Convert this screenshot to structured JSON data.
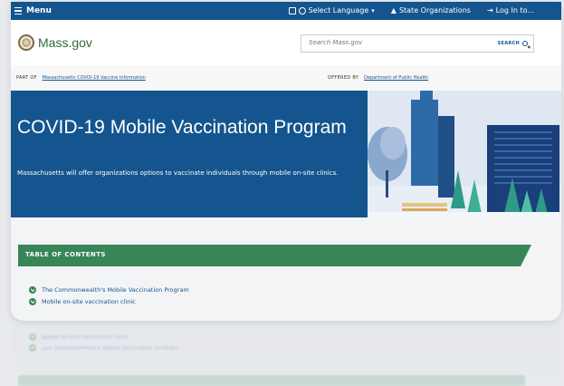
{
  "topbar": {
    "menu_label": "Menu",
    "language_label": "Select Language",
    "state_orgs_label": "State Organizations",
    "login_label": "Log In to..."
  },
  "header": {
    "logo_text": "Mass.gov",
    "search_placeholder": "Search Mass.gov",
    "search_button_label": "SEARCH"
  },
  "strip": {
    "part_of_label": "PART OF",
    "part_of_link": "Massachusetts COVID-19 Vaccine Information",
    "offered_by_label": "OFFERED BY",
    "offered_by_link": "Department of Public Health"
  },
  "hero": {
    "title": "COVID-19 Mobile Vaccination Program",
    "description": "Massachusetts will offer organizations options to vaccinate individuals through mobile on-site clinics."
  },
  "toc": {
    "heading": "TABLE OF CONTENTS",
    "items": [
      {
        "label": "The Commonwealth's Mobile Vaccination Program"
      },
      {
        "label": "Mobile on-site vaccination clinic"
      }
    ]
  },
  "colors": {
    "brand_blue": "#14558f",
    "brand_green": "#388557",
    "logo_green": "#2e6a3c"
  }
}
